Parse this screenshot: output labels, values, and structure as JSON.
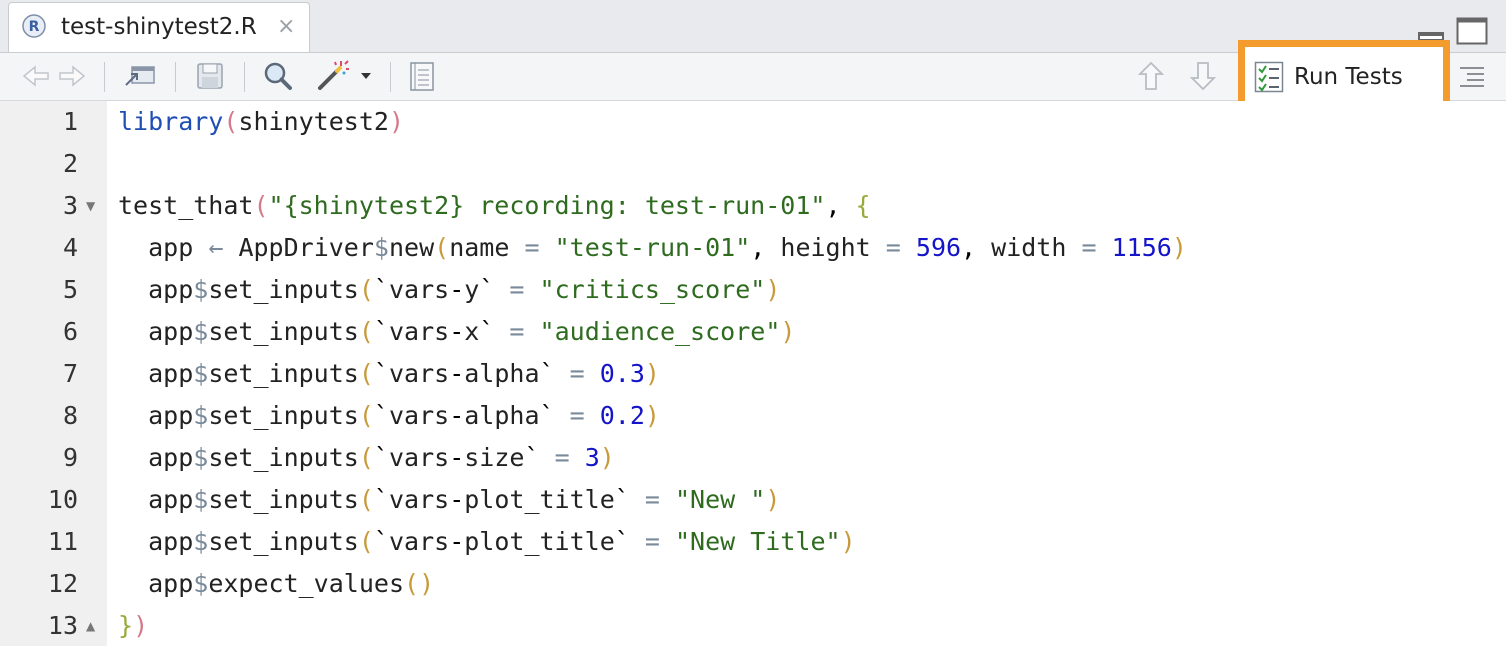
{
  "tab": {
    "title": "test-shinytest2.R",
    "close_glyph": "×",
    "language_badge": "R"
  },
  "toolbar": {
    "run_tests_label": "Run Tests",
    "icons": [
      "back-icon",
      "forward-icon",
      "show-in-window-icon",
      "save-icon",
      "search-icon",
      "magic-wand-icon",
      "dropdown-arrow-icon",
      "compile-report-icon",
      "go-up-icon",
      "go-down-icon",
      "checklist-icon",
      "outline-icon"
    ]
  },
  "editor": {
    "line_numbers": [
      "1",
      "2",
      "3",
      "4",
      "5",
      "6",
      "7",
      "8",
      "9",
      "10",
      "11",
      "12",
      "13"
    ],
    "lines": [
      "library(shinytest2)",
      "",
      "test_that(\"{shinytest2} recording: test-run-01\", {",
      "  app ← AppDriver$new(name = \"test-run-01\", height = 596, width = 1156)",
      "  app$set_inputs(`vars-y` = \"critics_score\")",
      "  app$set_inputs(`vars-x` = \"audience_score\")",
      "  app$set_inputs(`vars-alpha` = 0.3)",
      "  app$set_inputs(`vars-alpha` = 0.2)",
      "  app$set_inputs(`vars-size` = 3)",
      "  app$set_inputs(`vars-plot_title` = \"New \")",
      "  app$set_inputs(`vars-plot_title` = \"New Title\")",
      "  app$expect_values()",
      "})"
    ]
  },
  "colors": {
    "highlight": "#f39b2d",
    "keyword": "#1f4fb3",
    "string": "#2e6b1f",
    "number": "#1414c8"
  }
}
